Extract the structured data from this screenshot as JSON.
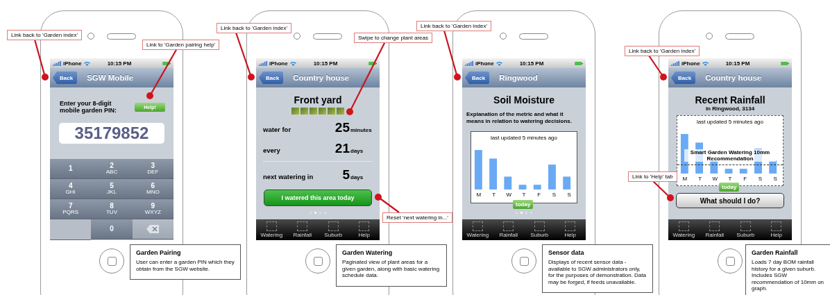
{
  "phones": [
    {
      "kind": "pin",
      "status": {
        "carrier": "iPhone",
        "time": "10:15 PM"
      },
      "nav": {
        "back": "Back",
        "title": "SGW Mobile"
      },
      "prompt": "Enter your 8-digit mobile garden PIN:",
      "help_button": "Help!",
      "pin": "35179852",
      "keys": [
        {
          "kind": "key",
          "digit": "1"
        },
        {
          "kind": "key",
          "digit": "2",
          "letters": "ABC"
        },
        {
          "kind": "key",
          "digit": "3",
          "letters": "DEF"
        },
        {
          "kind": "key",
          "digit": "4",
          "letters": "GHI"
        },
        {
          "kind": "key",
          "digit": "5",
          "letters": "JKL"
        },
        {
          "kind": "key",
          "digit": "6",
          "letters": "MNO"
        },
        {
          "kind": "key",
          "digit": "7",
          "letters": "PQRS"
        },
        {
          "kind": "key",
          "digit": "8",
          "letters": "TUV"
        },
        {
          "kind": "key",
          "digit": "9",
          "letters": "WXYZ"
        },
        {
          "kind": "blank"
        },
        {
          "kind": "key",
          "digit": "0"
        },
        {
          "kind": "delete"
        }
      ],
      "callouts": [
        {
          "text": "Link back to 'Garden index'"
        },
        {
          "text": "Link to 'Garden pairing help'"
        }
      ],
      "note": {
        "title": "Garden Pairing",
        "text": "User can enter a garden PIN which they obtain from the SGW website."
      }
    },
    {
      "kind": "watering",
      "status": {
        "carrier": "iPhone",
        "time": "10:15 PM"
      },
      "nav": {
        "back": "Back",
        "title": "Country house"
      },
      "area_title": "Front yard",
      "rows": [
        {
          "label": "water for",
          "value": "25",
          "unit": "minutes",
          "divider_before": false
        },
        {
          "label": "every",
          "value": "21",
          "unit": "days",
          "divider_before": false
        },
        {
          "label": "next watering in",
          "value": "5",
          "unit": "days",
          "divider_before": true
        }
      ],
      "button": "I watered this area today",
      "pages": [
        {
          "selected": false
        },
        {
          "selected": true
        },
        {
          "selected": false
        },
        {
          "selected": false
        }
      ],
      "tabs": [
        {
          "label": "Watering"
        },
        {
          "label": "Rainfall"
        },
        {
          "label": "Suburb"
        },
        {
          "label": "Help"
        }
      ],
      "callouts": [
        {
          "text": "Link back to 'Garden index'"
        },
        {
          "text": "Swipe to change plant areas"
        },
        {
          "text": "Reset 'next watering in...'"
        }
      ],
      "note": {
        "title": "Garden Watering",
        "text": "Paginated view of plant areas for a given garden, along with basic watering schedule data."
      }
    },
    {
      "kind": "sensor",
      "status": {
        "carrier": "iPhone",
        "time": "10:15 PM"
      },
      "nav": {
        "back": "Back",
        "title": "Ringwood"
      },
      "heading": "Soil Moisture",
      "description": "Explanation of the metric and what it means in relation to watering decisions.",
      "chart": {
        "updated": "last updated 5 minutes ago",
        "days": [
          "M",
          "T",
          "W",
          "T",
          "F",
          "S",
          "S"
        ],
        "today": "today"
      },
      "pages": [
        {
          "selected": false
        },
        {
          "selected": true
        },
        {
          "selected": false
        },
        {
          "selected": false
        }
      ],
      "tabs": [
        {
          "label": "Watering"
        },
        {
          "label": "Rainfall"
        },
        {
          "label": "Suburb"
        },
        {
          "label": "Help"
        }
      ],
      "callouts": [
        {
          "text": "Link back to 'Garden index'"
        }
      ],
      "note": {
        "title": "Sensor data",
        "text": "Displays of recent sensor data - available to SGW administrators only, for the purposes of demonstration. Data may be forged, if feeds unavailable."
      }
    },
    {
      "kind": "rainfall",
      "status": {
        "carrier": "iPhone",
        "time": "10:15 PM"
      },
      "nav": {
        "back": "Back",
        "title": "Country house"
      },
      "heading": "Recent Rainfall",
      "subheading": "in Ringwood, 3134",
      "chart": {
        "updated": "last updated 5 minutes ago",
        "threshold_label": "Smart Garden Watering 10mm Recommendation",
        "days": [
          "M",
          "T",
          "W",
          "T",
          "F",
          "S",
          "S"
        ],
        "today": "today"
      },
      "button": "What should I do?",
      "tabs": [
        {
          "label": "Watering"
        },
        {
          "label": "Rainfall"
        },
        {
          "label": "Suburb"
        },
        {
          "label": "Help"
        }
      ],
      "callouts": [
        {
          "text": "Link back to 'Garden index'"
        },
        {
          "text": "Link to 'Help' tab"
        }
      ],
      "note": {
        "title": "Garden Rainfall",
        "text": "Loads 7 day BOM rainfall history for a given suburb. Includes SGW recommendation of 10mm on graph."
      }
    }
  ]
}
